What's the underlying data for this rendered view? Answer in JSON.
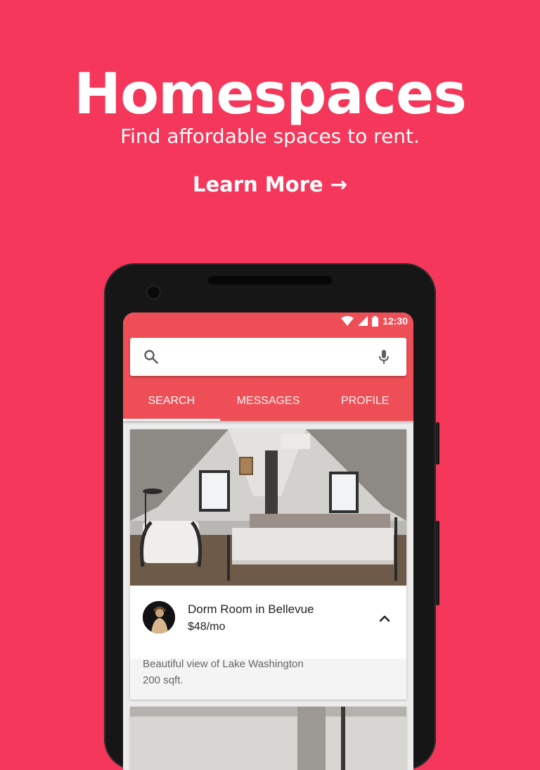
{
  "hero": {
    "title": "Homespaces",
    "subtitle": "Find affordable spaces to rent.",
    "cta": "Learn More →"
  },
  "status_bar": {
    "time": "12:30",
    "icons": [
      "wifi-icon",
      "signal-icon",
      "battery-icon"
    ]
  },
  "search": {
    "placeholder": "",
    "icons": [
      "search-icon",
      "mic-icon"
    ]
  },
  "tabs": [
    {
      "label": "SEARCH",
      "active": true
    },
    {
      "label": "MESSAGES",
      "active": false
    },
    {
      "label": "PROFILE",
      "active": false
    }
  ],
  "listing": {
    "title": "Dorm Room in Bellevue",
    "price": "$48/mo",
    "description_line1": "Beautiful view of Lake Washington",
    "description_line2": "200 sqft.",
    "expanded": true
  },
  "colors": {
    "background": "#f4375a",
    "appbar": "#ee4f57",
    "card": "#ffffff"
  }
}
